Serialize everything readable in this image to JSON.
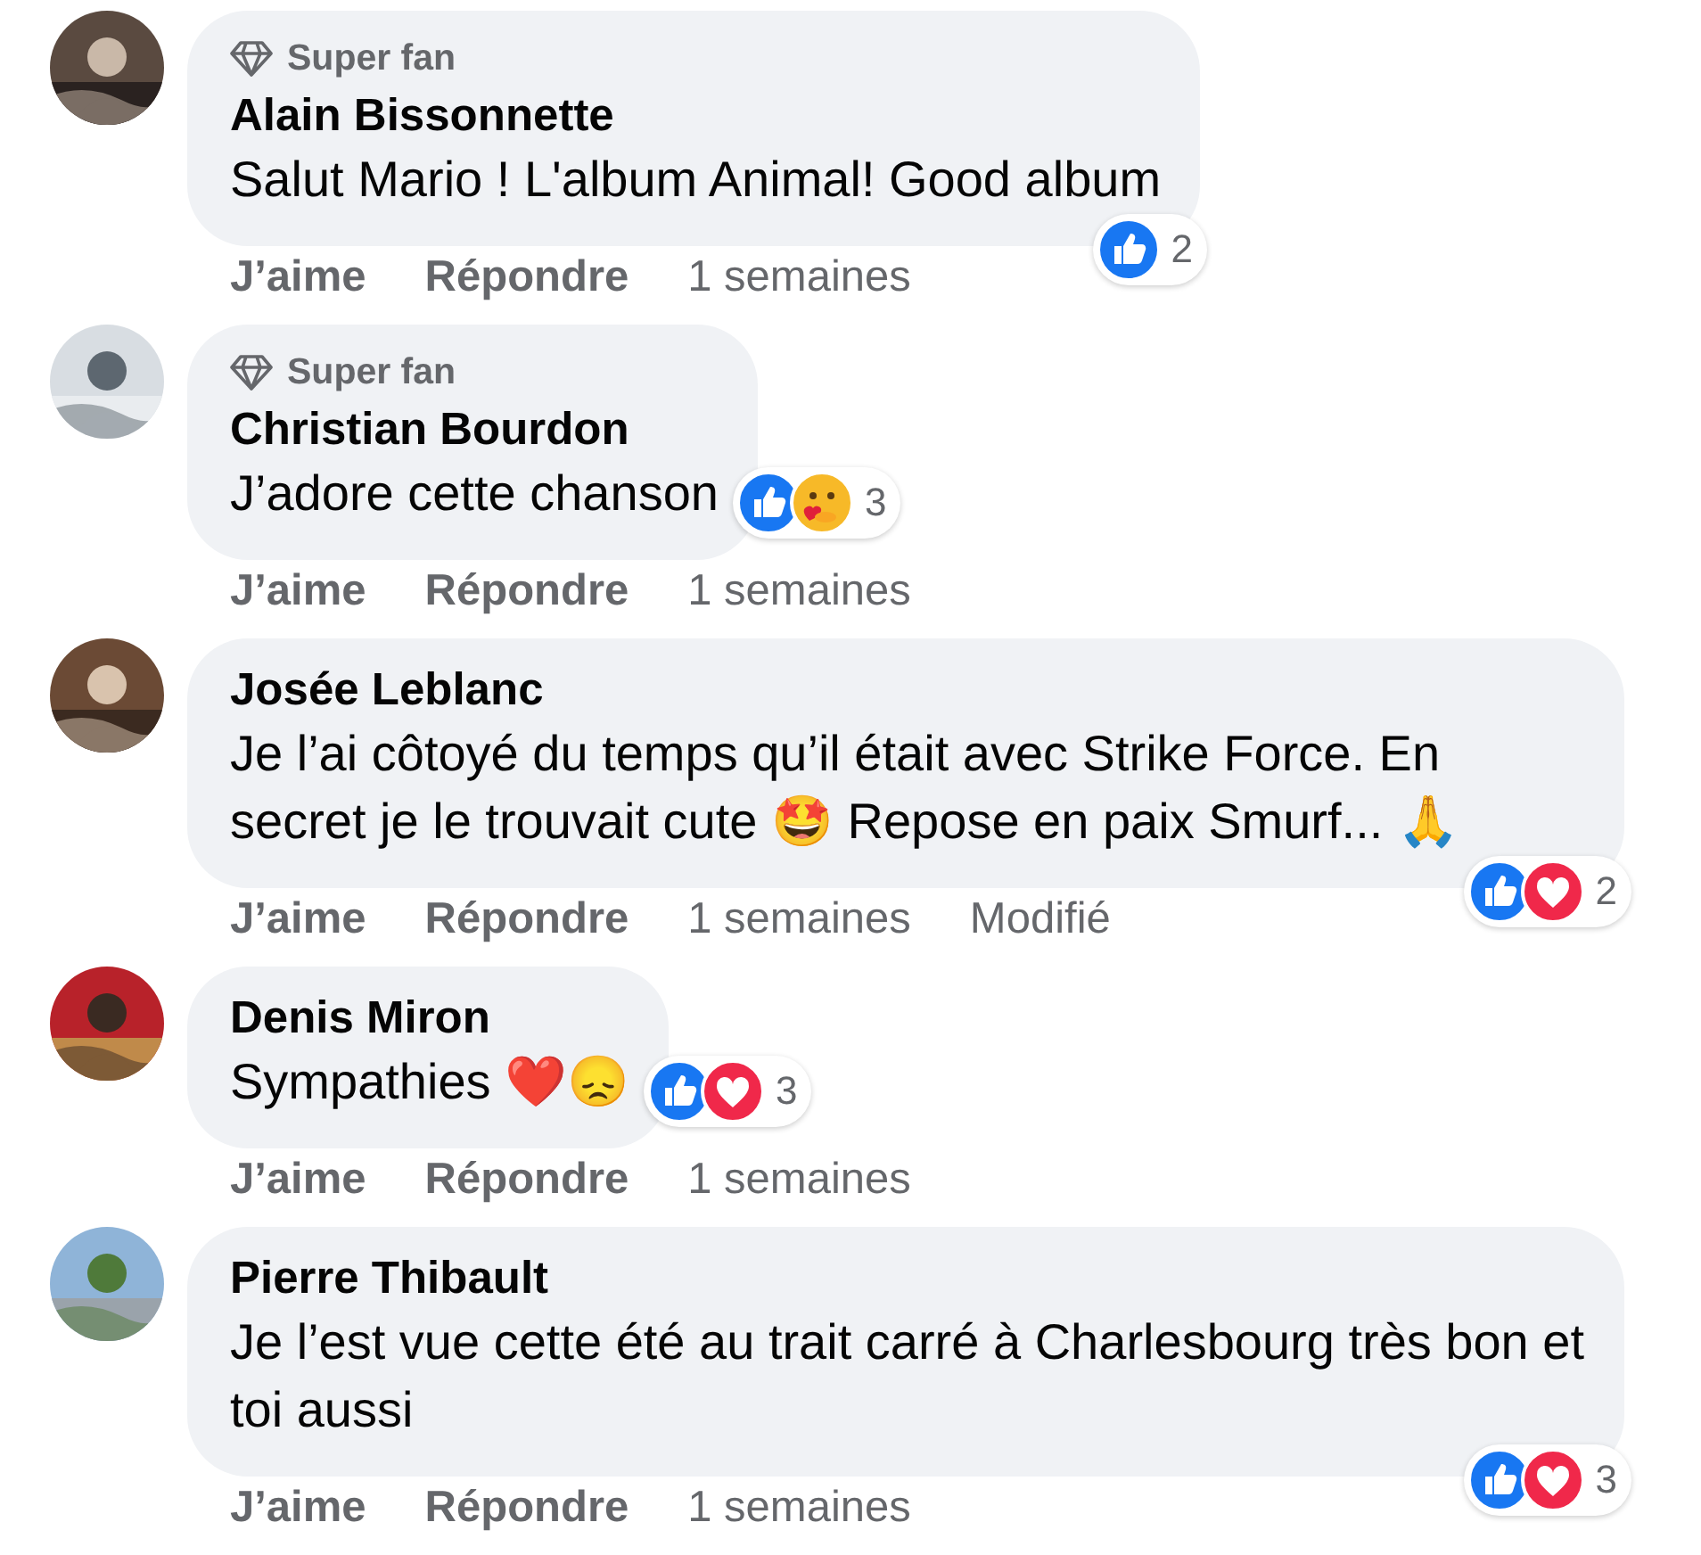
{
  "comments": [
    {
      "badge": "Super fan",
      "author": "Alain Bissonnette",
      "text": "Salut Mario ! L'album Animal! Good album",
      "reactions": {
        "icons": [
          {
            "kind": "like"
          }
        ],
        "count": "2"
      },
      "like_label": "J’aime",
      "reply_label": "Répondre",
      "time": "1 semaines"
    },
    {
      "badge": "Super fan",
      "author": "Christian Bourdon",
      "text": "J’adore cette chanson",
      "reactions": {
        "icons": [
          {
            "kind": "like"
          },
          {
            "kind": "care"
          }
        ],
        "count": "3"
      },
      "like_label": "J’aime",
      "reply_label": "Répondre",
      "time": "1 semaines"
    },
    {
      "author": "Josée Leblanc",
      "text": "Je l’ai côtoyé du temps qu’il était avec Strike Force. En secret je le trouvait cute 🤩 Repose en paix Smurf... 🙏",
      "reactions": {
        "icons": [
          {
            "kind": "like"
          },
          {
            "kind": "love"
          }
        ],
        "count": "2"
      },
      "like_label": "J’aime",
      "reply_label": "Répondre",
      "time": "1 semaines",
      "edited_label": "Modifié"
    },
    {
      "author": "Denis Miron",
      "text": "Sympathies ❤️😞",
      "reactions": {
        "icons": [
          {
            "kind": "like"
          },
          {
            "kind": "love"
          }
        ],
        "count": "3"
      },
      "like_label": "J’aime",
      "reply_label": "Répondre",
      "time": "1 semaines"
    },
    {
      "author": "Pierre Thibault",
      "text": "Je l’est vue cette été au trait carré à Charlesbourg très bon et toi aussi",
      "reactions": {
        "icons": [
          {
            "kind": "like"
          },
          {
            "kind": "love"
          }
        ],
        "count": "3"
      },
      "like_label": "J’aime",
      "reply_label": "Répondre",
      "time": "1 semaines"
    }
  ]
}
